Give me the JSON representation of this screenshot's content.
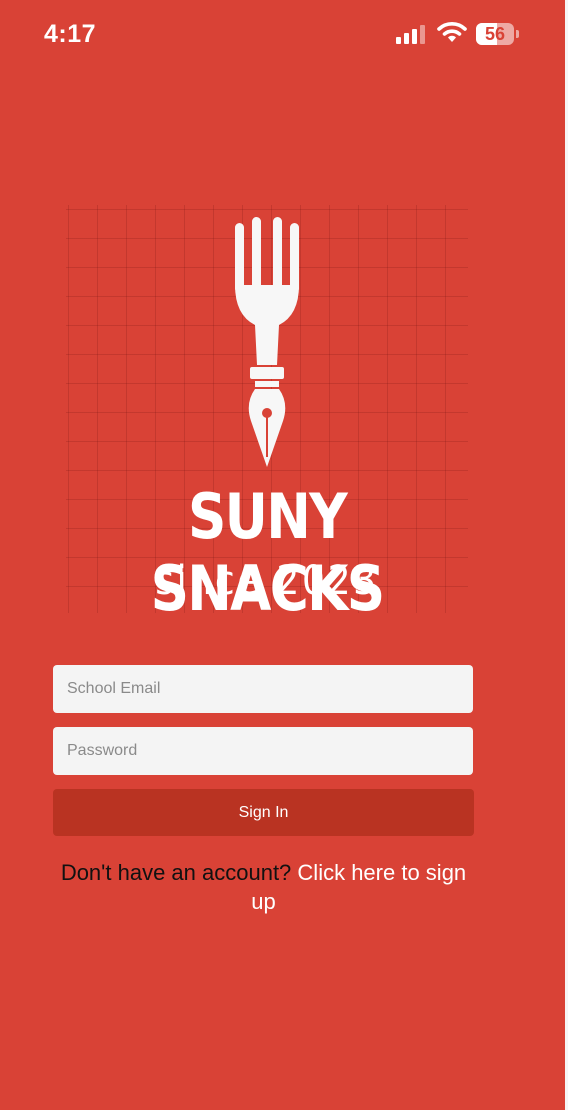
{
  "status_bar": {
    "time": "4:17",
    "battery_percent": 56,
    "battery_label": "56"
  },
  "brand": {
    "name": "SUNY SNACKS",
    "tagline": "since 2023",
    "logo_icon": "fork-pen-icon"
  },
  "form": {
    "email_placeholder": "School Email",
    "password_placeholder": "Password",
    "signin_label": "Sign In"
  },
  "signup": {
    "prompt": "Don't have an account?",
    "link": "Click here to sign up"
  },
  "colors": {
    "background": "#d94236",
    "button": "#b93322",
    "input": "#f4f4f4",
    "text_dark": "#111111",
    "text_light": "#ffffff"
  }
}
